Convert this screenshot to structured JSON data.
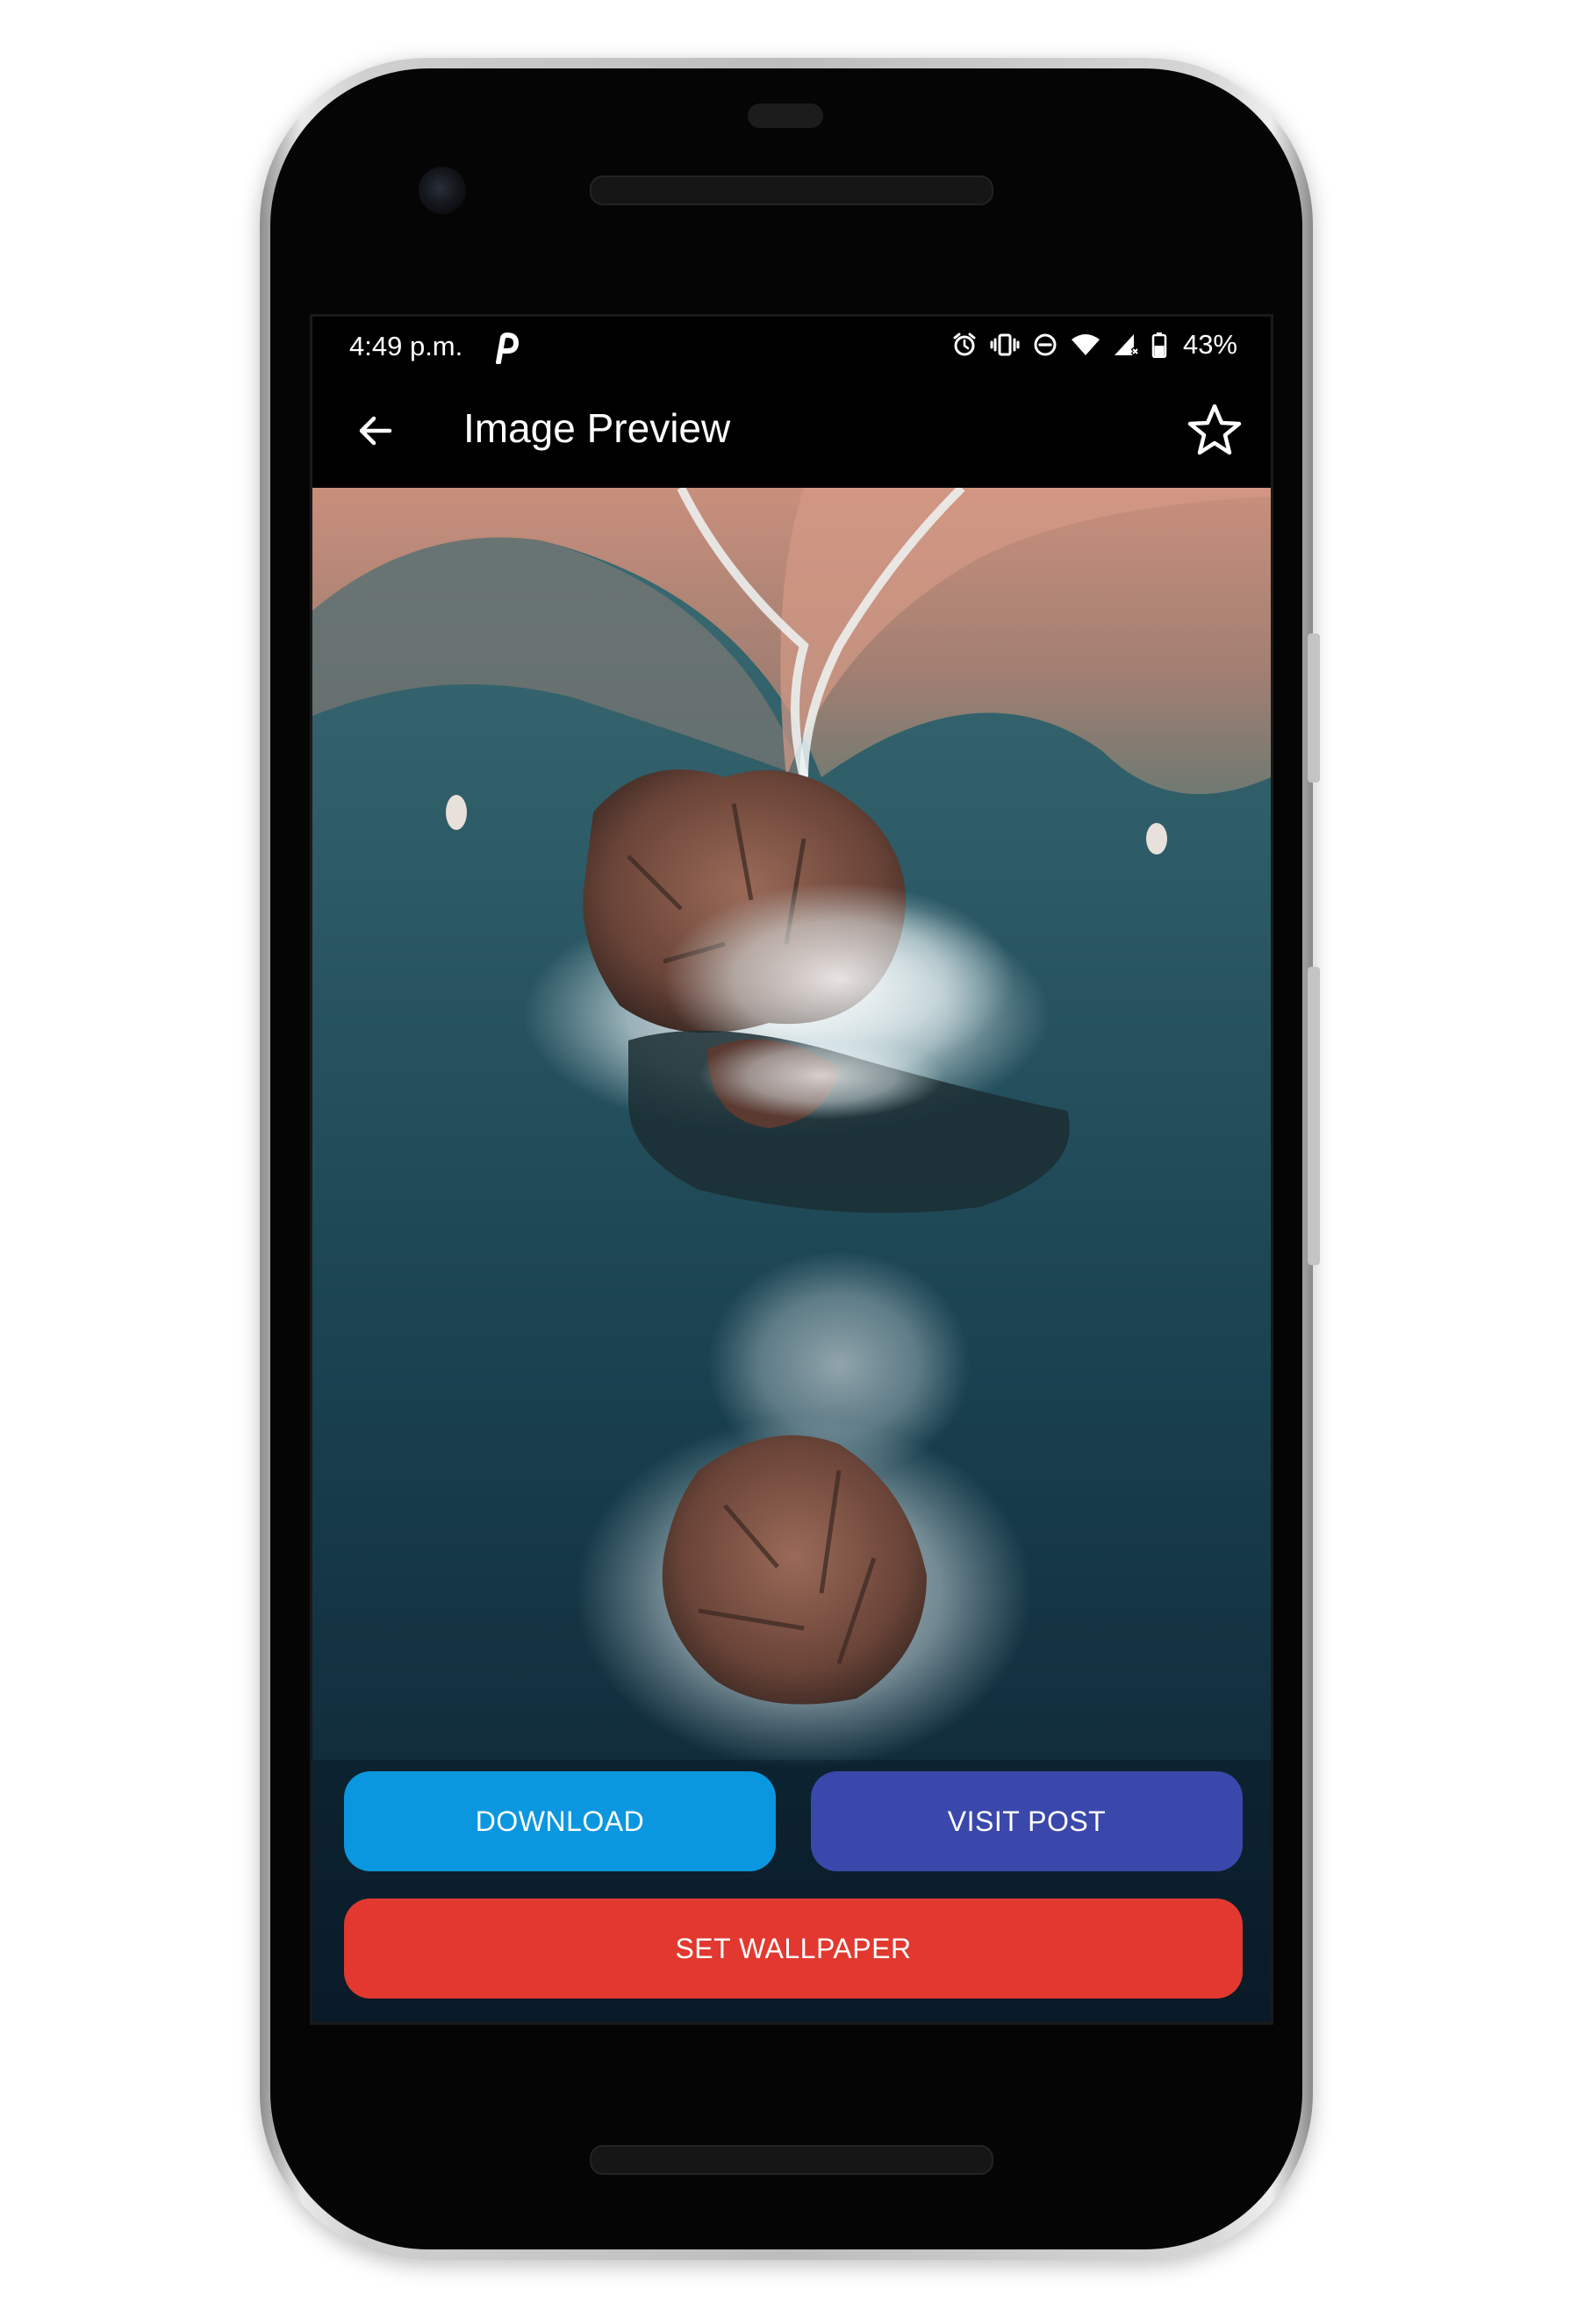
{
  "status_bar": {
    "time": "4:49 p.m.",
    "notification_icon": "pinterest-p-icon",
    "icons": [
      "alarm-icon",
      "vibrate-icon",
      "do-not-disturb-icon",
      "wifi-icon",
      "cell-signal-icon",
      "battery-icon"
    ],
    "battery_percent": "43%"
  },
  "app_bar": {
    "back_icon": "arrow-back-icon",
    "title": "Image Preview",
    "favorite_icon": "star-outline-icon"
  },
  "preview": {
    "subject": "aerial-beach-rocks-image"
  },
  "actions": {
    "download_label": "DOWNLOAD",
    "visit_post_label": "VISIT POST",
    "set_wallpaper_label": "SET WALLPAPER"
  },
  "colors": {
    "download": "#0a97e0",
    "visit_post": "#3a47ab",
    "set_wallpaper": "#e2382f",
    "app_bar_background": "#000000",
    "text": "#ffffff"
  }
}
